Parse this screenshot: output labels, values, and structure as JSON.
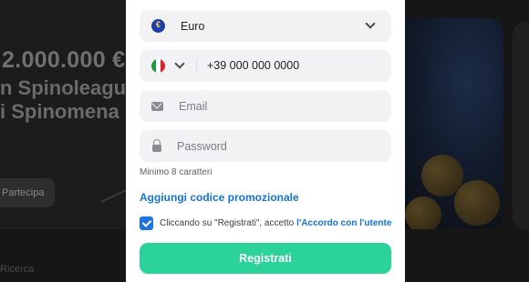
{
  "background": {
    "prize": "2.000.000 €",
    "line1": "n Spinoleague",
    "line2": "i Spinomena",
    "join_label": "Partecipa",
    "search_label": "Ricerca"
  },
  "form": {
    "currency": {
      "value": "Euro",
      "icon": "euro-flag-icon"
    },
    "phone": {
      "country_icon": "italy-flag-icon",
      "value": "+39 000 000 0000"
    },
    "email": {
      "placeholder": "Email",
      "icon": "mail-icon"
    },
    "password": {
      "placeholder": "Password",
      "icon": "lock-icon",
      "hint": "Minimo 8 caratteri"
    },
    "promo_label": "Aggiungi codice promozionale",
    "agreement": {
      "checked": true,
      "text": "Cliccando su \"Registrati\", accetto",
      "link": "l'Accordo con l'utente"
    },
    "submit_label": "Registrati"
  },
  "colors": {
    "accent_green": "#2bd39b",
    "link_blue": "#1473d6",
    "checkbox_blue": "#1a73e0",
    "field_bg": "#f2f2f4"
  }
}
